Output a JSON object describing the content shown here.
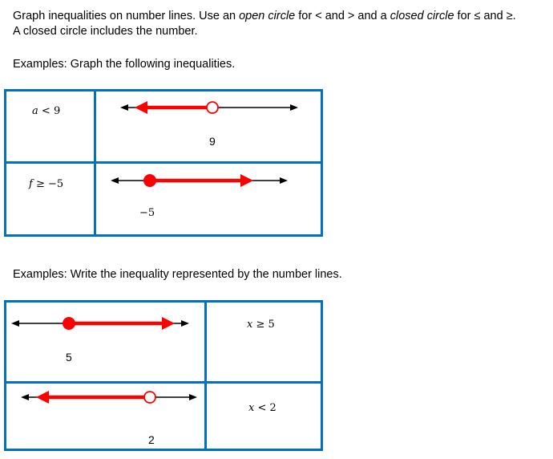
{
  "intro": {
    "line1_parts": [
      {
        "text": "Graph inequalities on number lines.  Use an ",
        "italic": false
      },
      {
        "text": "open circle",
        "italic": true
      },
      {
        "text": " for < and > and a ",
        "italic": false
      },
      {
        "text": "closed circle",
        "italic": true
      },
      {
        "text": " for ≤ and ≥.",
        "italic": false
      }
    ],
    "line2": "A closed circle includes the number."
  },
  "section1": {
    "heading": "Examples: Graph the following inequalities.",
    "rows": [
      {
        "variable": "a",
        "operator": "<",
        "value": "9",
        "point_label": "9",
        "circle": "open",
        "direction": "left"
      },
      {
        "variable": "f",
        "operator": "≥",
        "value": "−5",
        "point_label": "−5",
        "circle": "closed",
        "direction": "right"
      }
    ]
  },
  "section2": {
    "heading": "Examples: Write the inequality represented by the number lines.",
    "rows": [
      {
        "point_label": "5",
        "circle": "closed",
        "direction": "right",
        "variable": "x",
        "operator": "≥",
        "value": "5"
      },
      {
        "point_label": "2",
        "circle": "open",
        "direction": "left",
        "variable": "x",
        "operator": "<",
        "value": "2"
      }
    ]
  },
  "colors": {
    "table_border": "#0070c0",
    "graph_ray": "#ff0000",
    "axis": "#000000"
  }
}
